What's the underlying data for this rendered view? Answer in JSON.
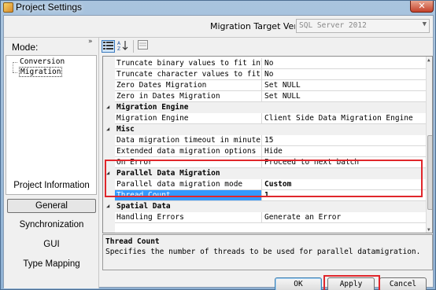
{
  "window": {
    "title": "Project Settings",
    "close_glyph": "✕"
  },
  "header": {
    "target_label": "Migration Target Versi",
    "target_value": "SQL Server 2012"
  },
  "mode": {
    "label": "Mode:",
    "tree": [
      "Conversion",
      "Migration"
    ],
    "selected_tree_item": "Migration",
    "nav": [
      "Project Information",
      "General",
      "Synchronization",
      "GUI",
      "Type Mapping"
    ],
    "active_nav": "General"
  },
  "toolbar": {
    "categorized_icon": "categorized-icon",
    "sort_icon": "alphabetical-sort-icon",
    "pages_icon": "property-pages-icon"
  },
  "grid": {
    "rows": [
      {
        "kind": "prop",
        "name": "Truncate binary values to fit into co",
        "value": "No"
      },
      {
        "kind": "prop",
        "name": "Truncate character values to fit into",
        "value": "No"
      },
      {
        "kind": "prop",
        "name": "Zero Dates Migration",
        "value": "Set NULL"
      },
      {
        "kind": "prop",
        "name": "Zero in Dates Migration",
        "value": "Set NULL"
      },
      {
        "kind": "cat",
        "name": "Migration Engine"
      },
      {
        "kind": "prop",
        "name": "Migration Engine",
        "value": "Client Side Data Migration Engine"
      },
      {
        "kind": "cat",
        "name": "Misc"
      },
      {
        "kind": "prop",
        "name": "Data migration timeout in minutes",
        "value": "15"
      },
      {
        "kind": "prop",
        "name": "Extended data migration options",
        "value": "Hide"
      },
      {
        "kind": "prop",
        "name": "On Error",
        "value": "Proceed to next batch"
      },
      {
        "kind": "cat",
        "name": "Parallel Data Migration"
      },
      {
        "kind": "prop",
        "name": "Parallel data migration mode",
        "value": "Custom",
        "bold": true
      },
      {
        "kind": "prop",
        "name": "Thread Count",
        "value": "1",
        "bold": true,
        "selected": true
      },
      {
        "kind": "cat",
        "name": "Spatial Data"
      },
      {
        "kind": "prop",
        "name": "Handling Errors",
        "value": "Generate an Error"
      }
    ]
  },
  "description": {
    "title": "Thread Count",
    "text": "Specifies the number of threads to be used for parallel datamigration."
  },
  "buttons": {
    "ok": "OK",
    "apply": "Apply",
    "cancel": "Cancel"
  },
  "colors": {
    "selection": "#3399ff",
    "highlight": "#e0262b"
  }
}
